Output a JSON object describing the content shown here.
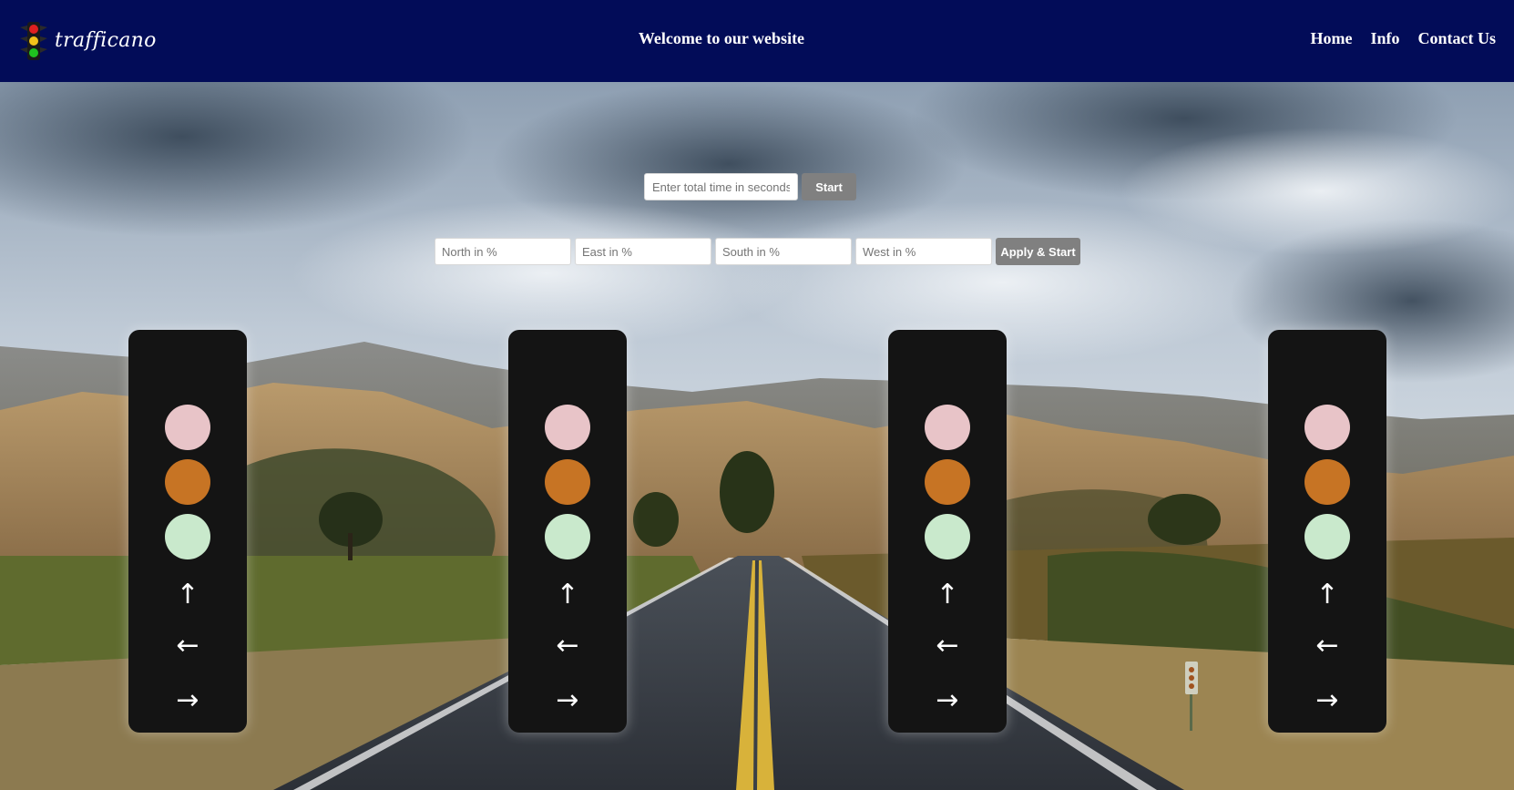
{
  "header": {
    "logo_text": "trafficano",
    "title": "Welcome to our website",
    "nav": [
      "Home",
      "Info",
      "Contact Us"
    ],
    "background_color": "#020c58"
  },
  "timer_form": {
    "placeholder": "Enter total time in seconds",
    "start_label": "Start"
  },
  "percent_form": {
    "north_placeholder": "North in %",
    "east_placeholder": "East in %",
    "south_placeholder": "South in %",
    "west_placeholder": "West in %",
    "apply_label": "Apply & Start"
  },
  "signals": [
    {
      "arrows": [
        "↑",
        "←",
        "→"
      ]
    },
    {
      "arrows": [
        "↑",
        "←",
        "→"
      ]
    },
    {
      "arrows": [
        "↑",
        "←",
        "→"
      ]
    },
    {
      "arrows": [
        "↑",
        "←",
        "→"
      ]
    }
  ],
  "colors": {
    "red_lamp": "#e8c4c8",
    "amber_lamp": "#c77424",
    "green_lamp": "#c9e9cc",
    "signal_body": "#141414",
    "button": "#808080"
  },
  "icons": {
    "logo": "traffic-light-icon"
  }
}
